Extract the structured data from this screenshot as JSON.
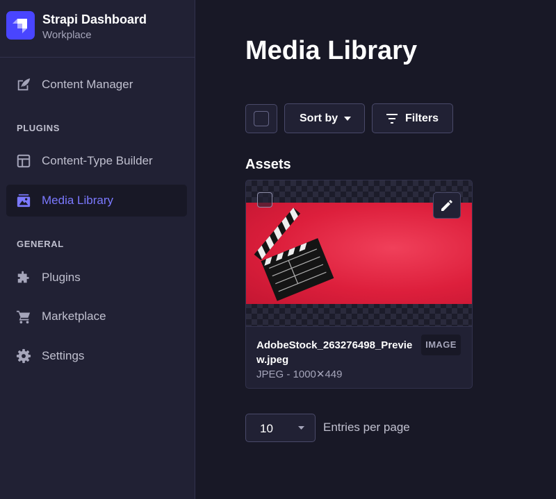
{
  "brand": {
    "title": "Strapi Dashboard",
    "subtitle": "Workplace"
  },
  "sidebar": {
    "items": [
      {
        "label": "Content Manager",
        "icon": "feather-icon"
      },
      {
        "label": "Content-Type Builder",
        "icon": "layout-icon"
      },
      {
        "label": "Media Library",
        "icon": "image-icon",
        "active": true
      },
      {
        "label": "Plugins",
        "icon": "puzzle-icon"
      },
      {
        "label": "Marketplace",
        "icon": "cart-icon"
      },
      {
        "label": "Settings",
        "icon": "gear-icon"
      }
    ],
    "sections": {
      "plugins": "PLUGINS",
      "general": "GENERAL"
    }
  },
  "main": {
    "title": "Media Library",
    "toolbar": {
      "sort_label": "Sort by",
      "filters_label": "Filters"
    },
    "assets_heading": "Assets",
    "asset": {
      "name": "AdobeStock_263276498_Preview.jpeg",
      "meta": "JPEG - 1000✕449",
      "badge": "IMAGE"
    },
    "pagination": {
      "page_size": "10",
      "entries_label": "Entries per page"
    }
  },
  "colors": {
    "background": "#181826",
    "sidebar": "#212134",
    "accent": "#4945ff",
    "active_text": "#7b79ff",
    "photo_red": "#dd1f3c"
  }
}
